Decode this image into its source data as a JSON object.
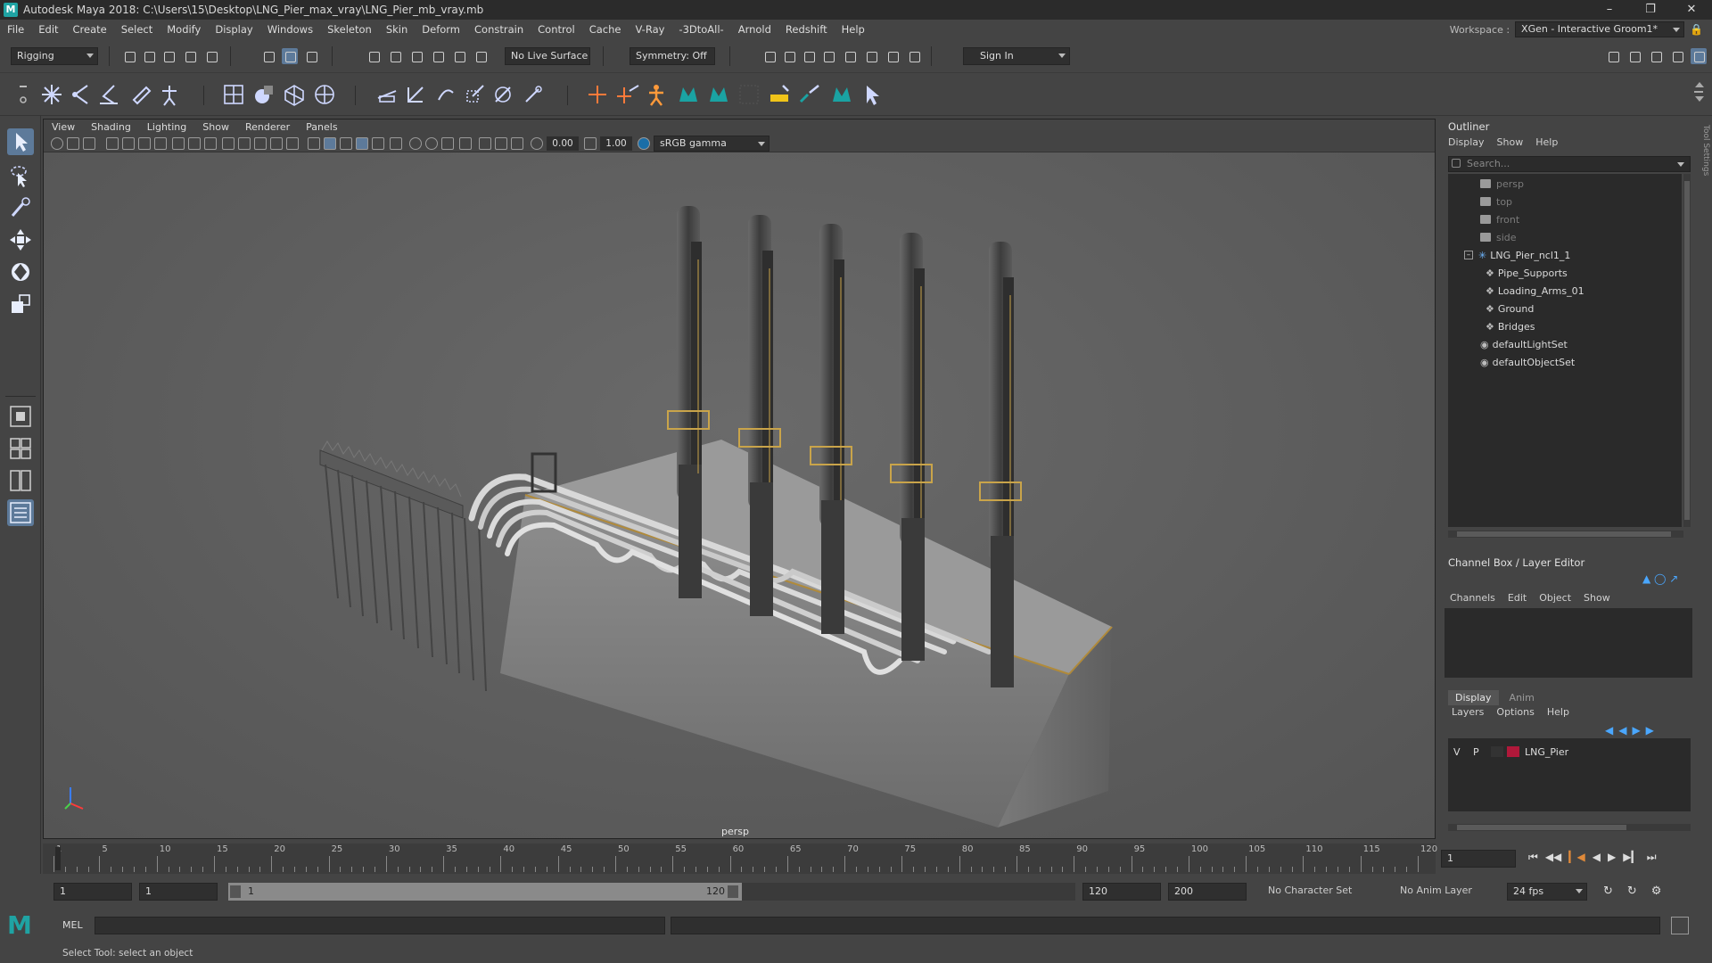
{
  "title_bar": {
    "text": "Autodesk Maya 2018: C:\\Users\\15\\Desktop\\LNG_Pier_max_vray\\LNG_Pier_mb_vray.mb"
  },
  "menu": [
    "File",
    "Edit",
    "Create",
    "Select",
    "Modify",
    "Display",
    "Windows",
    "Skeleton",
    "Skin",
    "Deform",
    "Constrain",
    "Control",
    "Cache",
    "V-Ray",
    "-3DtoAll-",
    "Arnold",
    "Redshift",
    "Help"
  ],
  "workspace": {
    "label": "Workspace :",
    "value": "XGen - Interactive Groom1*"
  },
  "status_line": {
    "mode": "Rigging",
    "live_surface": "No Live Surface",
    "symmetry": "Symmetry: Off",
    "sign_in": "Sign In"
  },
  "viewport": {
    "menu": [
      "View",
      "Shading",
      "Lighting",
      "Show",
      "Renderer",
      "Panels"
    ],
    "exposure": "0.00",
    "gamma": "1.00",
    "color_space": "sRGB gamma",
    "camera": "persp"
  },
  "outliner": {
    "title": "Outliner",
    "menu": [
      "Display",
      "Show",
      "Help"
    ],
    "search_placeholder": "Search...",
    "items": [
      {
        "label": "persp",
        "kind": "camera"
      },
      {
        "label": "top",
        "kind": "camera"
      },
      {
        "label": "front",
        "kind": "camera"
      },
      {
        "label": "side",
        "kind": "camera"
      },
      {
        "label": "LNG_Pier_ncl1_1",
        "kind": "joint"
      },
      {
        "label": "Pipe_Supports",
        "kind": "group"
      },
      {
        "label": "Loading_Arms_01",
        "kind": "group"
      },
      {
        "label": "Ground",
        "kind": "group"
      },
      {
        "label": "Bridges",
        "kind": "group"
      },
      {
        "label": "defaultLightSet",
        "kind": "set"
      },
      {
        "label": "defaultObjectSet",
        "kind": "set"
      }
    ]
  },
  "channel_box": {
    "title": "Channel Box / Layer Editor",
    "menu": [
      "Channels",
      "Edit",
      "Object",
      "Show"
    ]
  },
  "layer_editor": {
    "tabs": [
      "Display",
      "Anim"
    ],
    "menu": [
      "Layers",
      "Options",
      "Help"
    ],
    "layer": {
      "v": "V",
      "p": "P",
      "name": "LNG_Pier",
      "color": "#b0183a"
    }
  },
  "timeline": {
    "ticks": [
      "1",
      "5",
      "10",
      "15",
      "20",
      "25",
      "30",
      "35",
      "40",
      "45",
      "50",
      "55",
      "60",
      "65",
      "70",
      "75",
      "80",
      "85",
      "90",
      "95",
      "100",
      "105",
      "110",
      "115",
      "120"
    ],
    "current_frame": "1"
  },
  "range": {
    "start": "1",
    "playback_start": "1",
    "range_start_label": "1",
    "range_end_label": "120",
    "playback_end": "120",
    "end": "200",
    "character_set": "No Character Set",
    "anim_layer": "No Anim Layer",
    "fps": "24 fps"
  },
  "command_line": {
    "label": "MEL"
  },
  "help_line": {
    "text": "Select Tool: select an object"
  }
}
